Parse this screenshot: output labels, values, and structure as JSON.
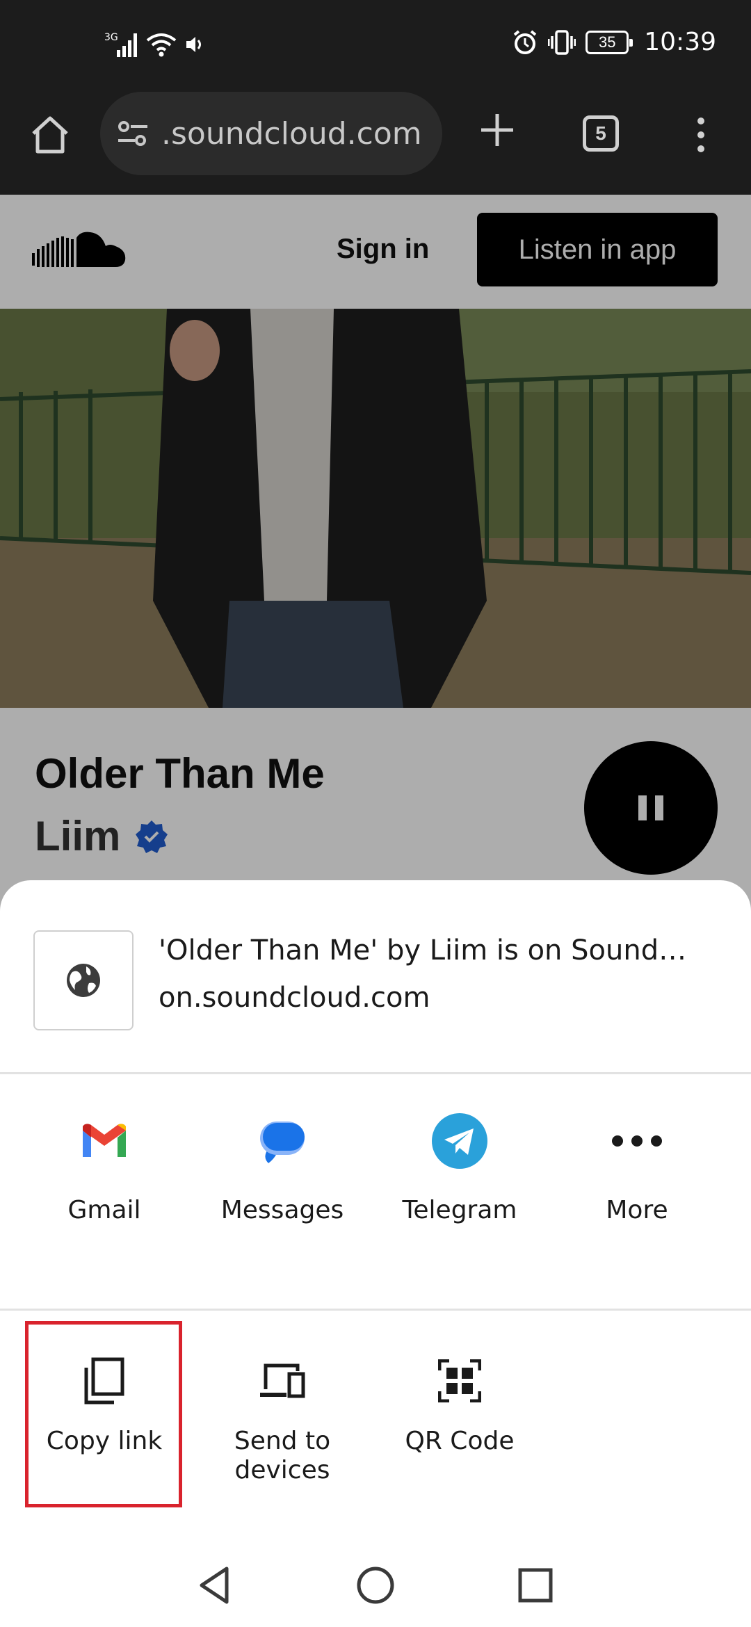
{
  "status_bar": {
    "network": "3G",
    "battery": "35",
    "time": "10:39"
  },
  "browser": {
    "url": ".soundcloud.com",
    "tab_count": "5"
  },
  "page": {
    "sign_in": "Sign in",
    "listen_in_app": "Listen in app",
    "track_title": "Older Than Me",
    "artist": "Liim"
  },
  "share_sheet": {
    "preview_title": "'Older Than Me' by Liim is on Sound…",
    "preview_url": "on.soundcloud.com",
    "apps": [
      {
        "label": "Gmail",
        "icon": "gmail-icon"
      },
      {
        "label": "Messages",
        "icon": "messages-icon"
      },
      {
        "label": "Telegram",
        "icon": "telegram-icon"
      },
      {
        "label": "More",
        "icon": "more-icon"
      }
    ],
    "actions": [
      {
        "label": "Copy link",
        "icon": "copy-icon"
      },
      {
        "label": "Send to devices",
        "icon": "devices-icon"
      },
      {
        "label": "QR Code",
        "icon": "qr-code-icon"
      }
    ]
  },
  "colors": {
    "highlight": "#d9232d",
    "telegram": "#2aa1da",
    "messages": "#1a73e8"
  }
}
